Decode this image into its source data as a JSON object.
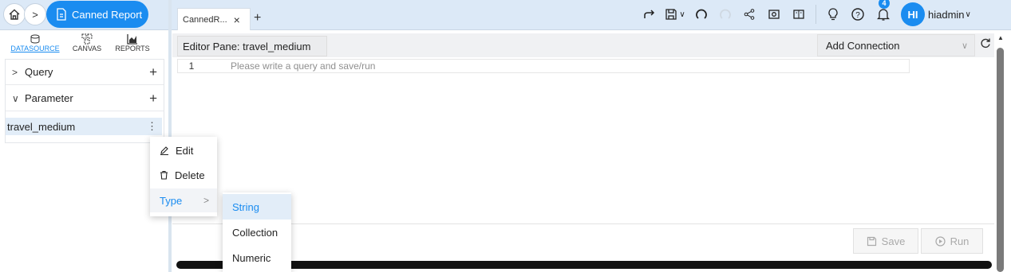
{
  "breadcrumb": {
    "home_icon": "home-icon",
    "page_label": "Canned Report"
  },
  "tabs": [
    {
      "label": "CannedR...",
      "close": "×"
    }
  ],
  "tab_add": "+",
  "user": {
    "initials": "HI",
    "name": "hiadmin",
    "notifications": "4"
  },
  "toolbar_icons": [
    "share-arrow-icon",
    "save-icon",
    "undo-icon",
    "redo-icon",
    "share-icon",
    "screenshot-icon",
    "panel-icon",
    "bulb-icon",
    "help-icon",
    "bell-icon"
  ],
  "left_nav": [
    {
      "label": "DATASOURCE",
      "active": true
    },
    {
      "label": "CANVAS"
    },
    {
      "label": "REPORTS"
    }
  ],
  "left_panel": {
    "query": {
      "label": "Query",
      "chevron": ">",
      "add": "+"
    },
    "parameter": {
      "label": "Parameter",
      "chevron": "∨",
      "add": "+"
    },
    "parameter_item": {
      "label": "travel_medium",
      "more": "⋮"
    }
  },
  "editor": {
    "title": "Editor Pane: travel_medium",
    "connection_placeholder": "Add Connection",
    "line_number": "1",
    "placeholder": "Please write a query and save/run",
    "save_label": "Save",
    "run_label": "Run"
  },
  "context_menu": {
    "edit": "Edit",
    "delete": "Delete",
    "type": "Type",
    "type_arrow": ">"
  },
  "type_menu": {
    "items": [
      "String",
      "Collection",
      "Numeric"
    ],
    "selected": "String"
  },
  "colors": {
    "accent": "#1a8cf0",
    "topbar": "#dce9f7",
    "highlight": "#e2edf8"
  }
}
